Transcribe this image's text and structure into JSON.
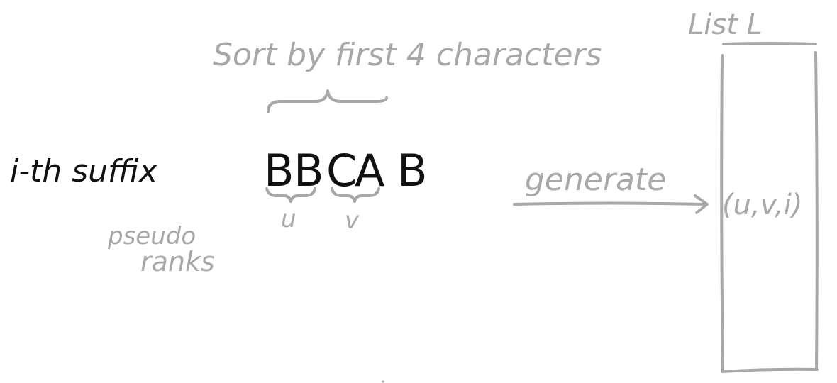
{
  "diagram": {
    "list_title": "List  L",
    "sort_caption": "Sort by first 4 characters",
    "suffix_label": "i-th suffix",
    "string_letters": [
      "B",
      "B",
      "C",
      "A",
      "B"
    ],
    "pair_first": "u",
    "pair_second": "v",
    "pseudo_label": "pseudo",
    "ranks_label": "ranks",
    "generate_label": "generate",
    "tuple_label": "(u,v,i)"
  },
  "colors": {
    "annotation": "#a8a8a8",
    "ink": "#111111"
  }
}
